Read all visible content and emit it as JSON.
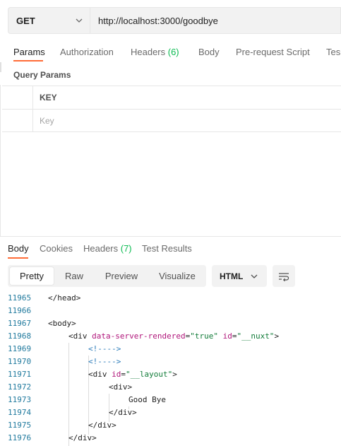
{
  "request": {
    "method": "GET",
    "url": "http://localhost:3000/goodbye"
  },
  "request_tabs": [
    {
      "label": "Params",
      "active": true
    },
    {
      "label": "Authorization"
    },
    {
      "label": "Headers ",
      "count": "(6)"
    },
    {
      "label": "Body"
    },
    {
      "label": "Pre-request Script"
    },
    {
      "label": "Tes"
    }
  ],
  "query_params": {
    "title": "Query Params",
    "column_header": "KEY",
    "key_placeholder": "Key"
  },
  "response_tabs": [
    {
      "label": "Body",
      "active": true
    },
    {
      "label": "Cookies"
    },
    {
      "label": "Headers ",
      "count": "(7)"
    },
    {
      "label": "Test Results"
    }
  ],
  "view_modes": [
    "Pretty",
    "Raw",
    "Preview",
    "Visualize"
  ],
  "active_view_mode": "Pretty",
  "language": "HTML",
  "code_lines": [
    {
      "num": "11965",
      "tokens": [
        {
          "t": "</head>",
          "k": "tag"
        }
      ]
    },
    {
      "num": "11966",
      "tokens": []
    },
    {
      "num": "11967",
      "tokens": [
        {
          "t": "<body>",
          "k": "tag"
        }
      ]
    },
    {
      "num": "11968",
      "tokens": [
        {
          "t": "<div ",
          "k": "tag"
        },
        {
          "t": "data-server-rendered",
          "k": "attr"
        },
        {
          "t": "=",
          "k": "tag"
        },
        {
          "t": "\"true\"",
          "k": "val"
        },
        {
          "t": " ",
          "k": "tag"
        },
        {
          "t": "id",
          "k": "attr"
        },
        {
          "t": "=",
          "k": "tag"
        },
        {
          "t": "\"__nuxt\"",
          "k": "val"
        },
        {
          "t": ">",
          "k": "tag"
        }
      ]
    },
    {
      "num": "11969",
      "tokens": [
        {
          "t": "<!---->",
          "k": "cmt"
        }
      ]
    },
    {
      "num": "11970",
      "tokens": [
        {
          "t": "<!---->",
          "k": "cmt"
        }
      ]
    },
    {
      "num": "11971",
      "tokens": [
        {
          "t": "<div ",
          "k": "tag"
        },
        {
          "t": "id",
          "k": "attr"
        },
        {
          "t": "=",
          "k": "tag"
        },
        {
          "t": "\"__layout\"",
          "k": "val"
        },
        {
          "t": ">",
          "k": "tag"
        }
      ]
    },
    {
      "num": "11972",
      "tokens": [
        {
          "t": "<div>",
          "k": "tag"
        }
      ]
    },
    {
      "num": "11973",
      "tokens": [
        {
          "t": "Good Bye",
          "k": "tag"
        }
      ]
    },
    {
      "num": "11974",
      "tokens": [
        {
          "t": "</div>",
          "k": "tag"
        }
      ]
    },
    {
      "num": "11975",
      "tokens": [
        {
          "t": "</div>",
          "k": "tag"
        }
      ]
    },
    {
      "num": "11976",
      "tokens": [
        {
          "t": "</div>",
          "k": "tag"
        }
      ]
    }
  ],
  "colors": {
    "accent": "#ff6c37",
    "count_green": "#0cbb52",
    "line_number": "#217a9e",
    "attribute": "#b0157a",
    "string": "#127c39",
    "comment": "#2b7bb9"
  }
}
